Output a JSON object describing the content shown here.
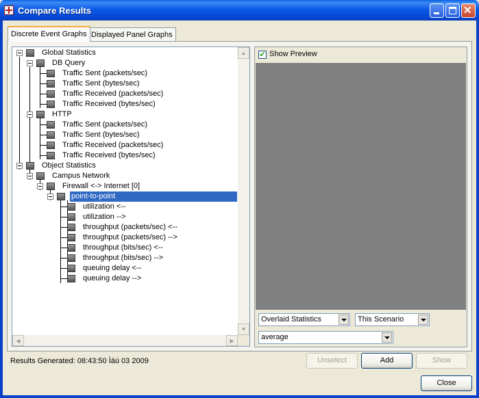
{
  "window": {
    "title": "Compare Results",
    "icon": "opnet-app-icon",
    "controls": [
      "minimize-icon",
      "maximize-icon",
      "close-icon"
    ]
  },
  "tabs": [
    {
      "label": "Discrete Event Graphs",
      "active": true
    },
    {
      "label": "Displayed Panel Graphs",
      "active": false
    }
  ],
  "tree": {
    "global": {
      "label": "Global Statistics",
      "db_query": {
        "label": "DB Query",
        "items": [
          "Traffic Sent (packets/sec)",
          "Traffic Sent (bytes/sec)",
          "Traffic Received (packets/sec)",
          "Traffic Received (bytes/sec)"
        ]
      },
      "http": {
        "label": "HTTP",
        "items": [
          "Traffic Sent (packets/sec)",
          "Traffic Sent (bytes/sec)",
          "Traffic Received (packets/sec)",
          "Traffic Received (bytes/sec)"
        ]
      }
    },
    "object": {
      "label": "Object Statistics",
      "campus": {
        "label": "Campus Network",
        "firewall": {
          "label": "Firewall <-> Internet [0]",
          "ptp": {
            "label": "point-to-point",
            "selected": true,
            "items": [
              "utilization <--",
              "utilization -->",
              "throughput (packets/sec) <--",
              "throughput (packets/sec) -->",
              "throughput (bits/sec) <--",
              "throughput (bits/sec) -->",
              "queuing delay <--",
              "queuing delay -->"
            ]
          }
        }
      }
    }
  },
  "preview": {
    "show_preview_label": "Show Preview",
    "show_preview_checked": true,
    "preview_bg": "#808080"
  },
  "options": {
    "mode_select": "Overlaid Statistics",
    "scenario_select": "This Scenario",
    "filter_select": "average"
  },
  "status": {
    "results_generated": "Results Generated: 08:43:50 Ìáú 03 2009"
  },
  "buttons": {
    "unselect": "Unselect",
    "add": "Add",
    "show": "Show",
    "close": "Close"
  }
}
